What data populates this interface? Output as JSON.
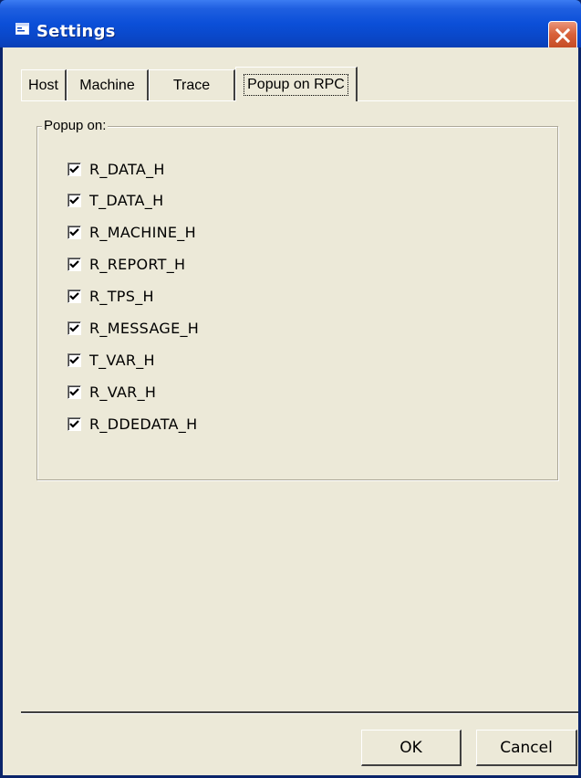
{
  "window": {
    "title": "Settings"
  },
  "tabs": [
    {
      "label": "Host",
      "active": false
    },
    {
      "label": "Machine",
      "active": false
    },
    {
      "label": "Trace",
      "active": false
    },
    {
      "label": "Popup on RPC",
      "active": true
    }
  ],
  "group": {
    "legend": "Popup on:",
    "items": [
      {
        "label": "R_DATA_H",
        "checked": true
      },
      {
        "label": "T_DATA_H",
        "checked": true
      },
      {
        "label": "R_MACHINE_H",
        "checked": true
      },
      {
        "label": "R_REPORT_H",
        "checked": true
      },
      {
        "label": "R_TPS_H",
        "checked": true
      },
      {
        "label": "R_MESSAGE_H",
        "checked": true
      },
      {
        "label": "T_VAR_H",
        "checked": true
      },
      {
        "label": "R_VAR_H",
        "checked": true
      },
      {
        "label": "R_DDEDATA_H",
        "checked": true
      }
    ]
  },
  "buttons": {
    "ok": "OK",
    "cancel": "Cancel"
  },
  "colors": {
    "titlebar": "#0b4fd8",
    "face": "#ece9d8",
    "close": "#d9613a"
  },
  "icons": {
    "title": "window-app-icon",
    "close": "close-icon",
    "check": "checkmark-icon"
  }
}
